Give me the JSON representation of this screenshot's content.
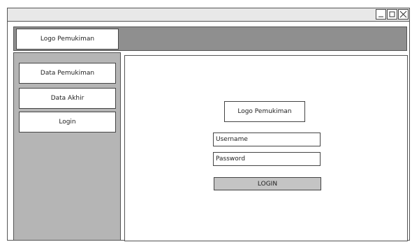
{
  "window": {
    "controls": [
      {
        "icon": "minimize-icon"
      },
      {
        "icon": "maximize-icon"
      },
      {
        "icon": "close-icon"
      }
    ]
  },
  "header": {
    "logo_text": "Logo Pemukiman"
  },
  "sidebar": {
    "items": [
      {
        "label": "Data Pemukiman"
      },
      {
        "label": "Data Akhir"
      },
      {
        "label": "Login"
      }
    ]
  },
  "login_form": {
    "logo_text": "Logo Pemukiman",
    "username_value": "Username",
    "password_value": "Password",
    "submit_label": "LOGIN"
  }
}
